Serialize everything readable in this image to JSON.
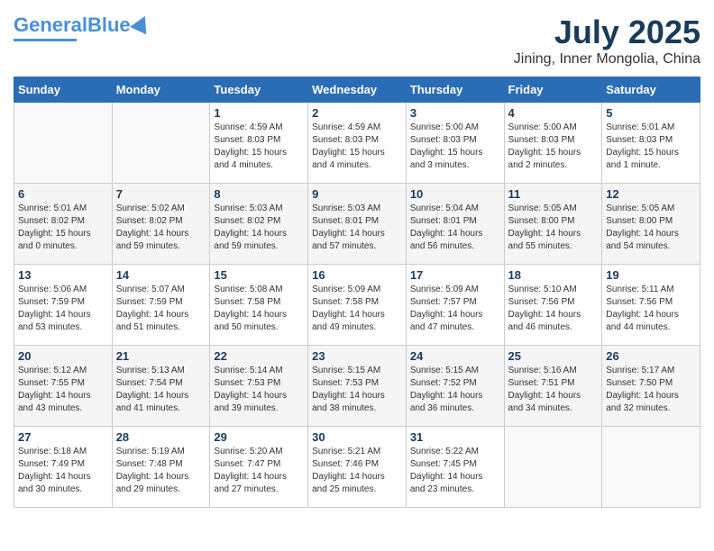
{
  "logo": {
    "text_general": "General",
    "text_blue": "Blue"
  },
  "title": "July 2025",
  "location": "Jining, Inner Mongolia, China",
  "weekdays": [
    "Sunday",
    "Monday",
    "Tuesday",
    "Wednesday",
    "Thursday",
    "Friday",
    "Saturday"
  ],
  "weeks": [
    [
      {
        "day": "",
        "info": ""
      },
      {
        "day": "",
        "info": ""
      },
      {
        "day": "1",
        "info": "Sunrise: 4:59 AM\nSunset: 8:03 PM\nDaylight: 15 hours\nand 4 minutes."
      },
      {
        "day": "2",
        "info": "Sunrise: 4:59 AM\nSunset: 8:03 PM\nDaylight: 15 hours\nand 4 minutes."
      },
      {
        "day": "3",
        "info": "Sunrise: 5:00 AM\nSunset: 8:03 PM\nDaylight: 15 hours\nand 3 minutes."
      },
      {
        "day": "4",
        "info": "Sunrise: 5:00 AM\nSunset: 8:03 PM\nDaylight: 15 hours\nand 2 minutes."
      },
      {
        "day": "5",
        "info": "Sunrise: 5:01 AM\nSunset: 8:03 PM\nDaylight: 15 hours\nand 1 minute."
      }
    ],
    [
      {
        "day": "6",
        "info": "Sunrise: 5:01 AM\nSunset: 8:02 PM\nDaylight: 15 hours\nand 0 minutes."
      },
      {
        "day": "7",
        "info": "Sunrise: 5:02 AM\nSunset: 8:02 PM\nDaylight: 14 hours\nand 59 minutes."
      },
      {
        "day": "8",
        "info": "Sunrise: 5:03 AM\nSunset: 8:02 PM\nDaylight: 14 hours\nand 59 minutes."
      },
      {
        "day": "9",
        "info": "Sunrise: 5:03 AM\nSunset: 8:01 PM\nDaylight: 14 hours\nand 57 minutes."
      },
      {
        "day": "10",
        "info": "Sunrise: 5:04 AM\nSunset: 8:01 PM\nDaylight: 14 hours\nand 56 minutes."
      },
      {
        "day": "11",
        "info": "Sunrise: 5:05 AM\nSunset: 8:00 PM\nDaylight: 14 hours\nand 55 minutes."
      },
      {
        "day": "12",
        "info": "Sunrise: 5:05 AM\nSunset: 8:00 PM\nDaylight: 14 hours\nand 54 minutes."
      }
    ],
    [
      {
        "day": "13",
        "info": "Sunrise: 5:06 AM\nSunset: 7:59 PM\nDaylight: 14 hours\nand 53 minutes."
      },
      {
        "day": "14",
        "info": "Sunrise: 5:07 AM\nSunset: 7:59 PM\nDaylight: 14 hours\nand 51 minutes."
      },
      {
        "day": "15",
        "info": "Sunrise: 5:08 AM\nSunset: 7:58 PM\nDaylight: 14 hours\nand 50 minutes."
      },
      {
        "day": "16",
        "info": "Sunrise: 5:09 AM\nSunset: 7:58 PM\nDaylight: 14 hours\nand 49 minutes."
      },
      {
        "day": "17",
        "info": "Sunrise: 5:09 AM\nSunset: 7:57 PM\nDaylight: 14 hours\nand 47 minutes."
      },
      {
        "day": "18",
        "info": "Sunrise: 5:10 AM\nSunset: 7:56 PM\nDaylight: 14 hours\nand 46 minutes."
      },
      {
        "day": "19",
        "info": "Sunrise: 5:11 AM\nSunset: 7:56 PM\nDaylight: 14 hours\nand 44 minutes."
      }
    ],
    [
      {
        "day": "20",
        "info": "Sunrise: 5:12 AM\nSunset: 7:55 PM\nDaylight: 14 hours\nand 43 minutes."
      },
      {
        "day": "21",
        "info": "Sunrise: 5:13 AM\nSunset: 7:54 PM\nDaylight: 14 hours\nand 41 minutes."
      },
      {
        "day": "22",
        "info": "Sunrise: 5:14 AM\nSunset: 7:53 PM\nDaylight: 14 hours\nand 39 minutes."
      },
      {
        "day": "23",
        "info": "Sunrise: 5:15 AM\nSunset: 7:53 PM\nDaylight: 14 hours\nand 38 minutes."
      },
      {
        "day": "24",
        "info": "Sunrise: 5:15 AM\nSunset: 7:52 PM\nDaylight: 14 hours\nand 36 minutes."
      },
      {
        "day": "25",
        "info": "Sunrise: 5:16 AM\nSunset: 7:51 PM\nDaylight: 14 hours\nand 34 minutes."
      },
      {
        "day": "26",
        "info": "Sunrise: 5:17 AM\nSunset: 7:50 PM\nDaylight: 14 hours\nand 32 minutes."
      }
    ],
    [
      {
        "day": "27",
        "info": "Sunrise: 5:18 AM\nSunset: 7:49 PM\nDaylight: 14 hours\nand 30 minutes."
      },
      {
        "day": "28",
        "info": "Sunrise: 5:19 AM\nSunset: 7:48 PM\nDaylight: 14 hours\nand 29 minutes."
      },
      {
        "day": "29",
        "info": "Sunrise: 5:20 AM\nSunset: 7:47 PM\nDaylight: 14 hours\nand 27 minutes."
      },
      {
        "day": "30",
        "info": "Sunrise: 5:21 AM\nSunset: 7:46 PM\nDaylight: 14 hours\nand 25 minutes."
      },
      {
        "day": "31",
        "info": "Sunrise: 5:22 AM\nSunset: 7:45 PM\nDaylight: 14 hours\nand 23 minutes."
      },
      {
        "day": "",
        "info": ""
      },
      {
        "day": "",
        "info": ""
      }
    ]
  ]
}
